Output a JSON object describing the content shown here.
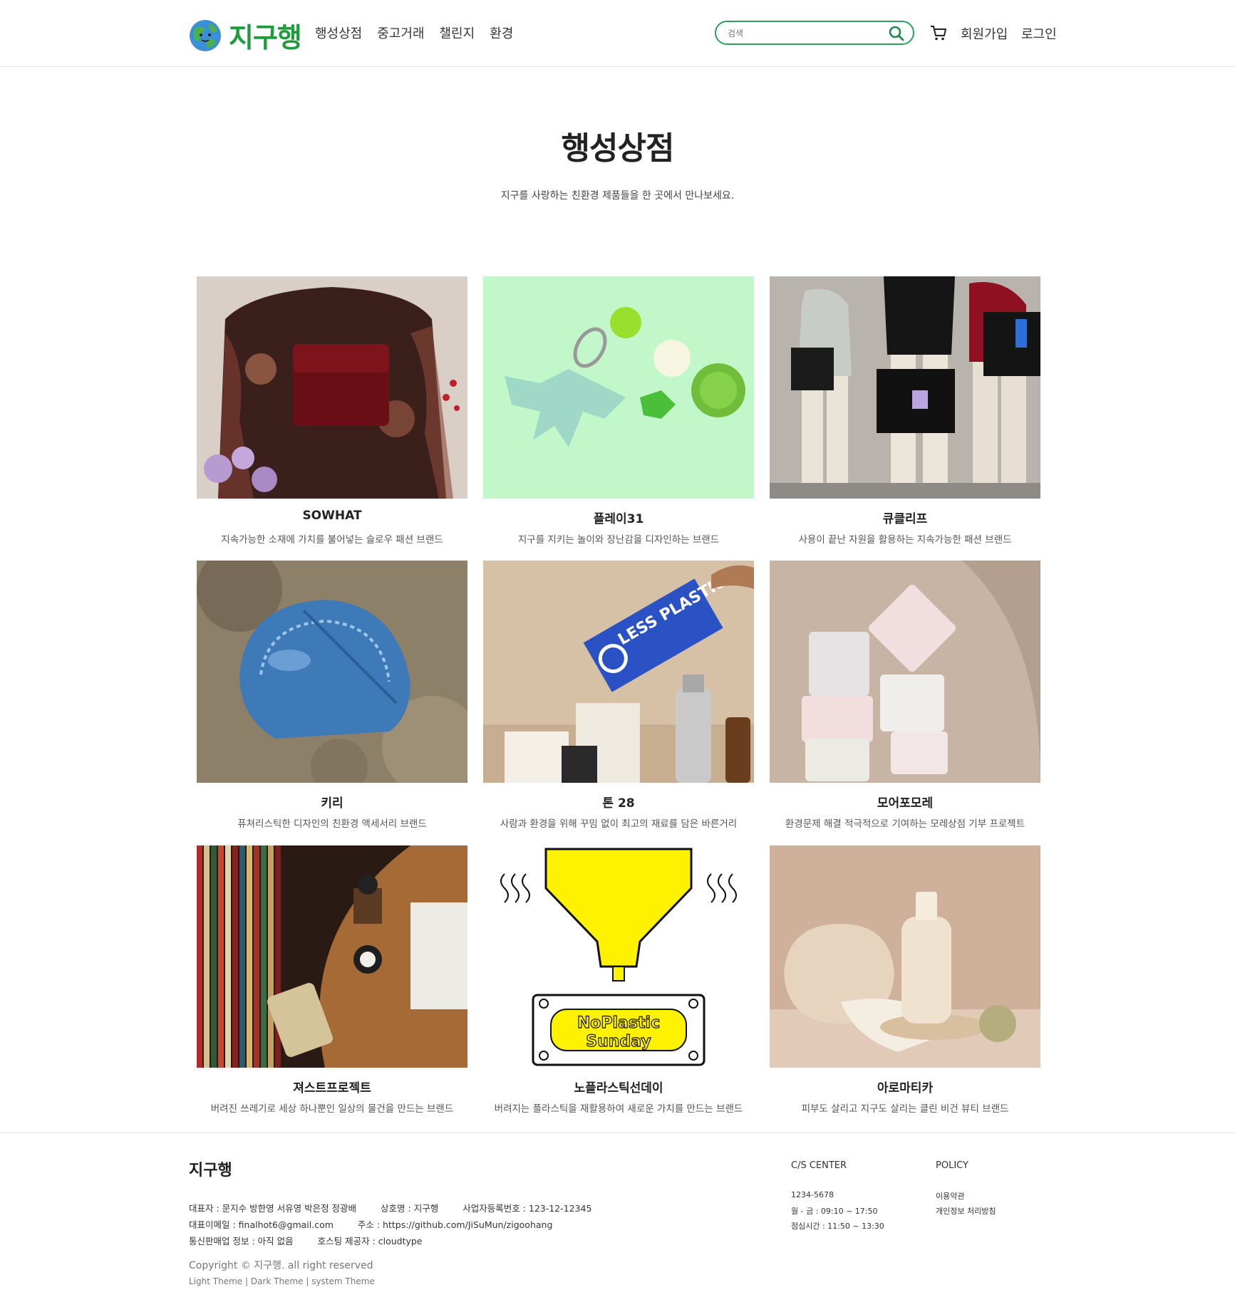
{
  "header": {
    "logo_text": "지구행",
    "nav": [
      "행성상점",
      "중고거래",
      "챌린지",
      "환경"
    ],
    "search_placeholder": "검색",
    "signup": "회원가입",
    "login": "로그인"
  },
  "main": {
    "title": "행성상점",
    "subtitle": "지구를 사랑하는 친환경 제품들을 한 곳에서 만나보세요."
  },
  "brands": [
    {
      "name": "SOWHAT",
      "desc": "지속가능한 소재에 가치를 불어넣는 슬로우 패션 브랜드"
    },
    {
      "name": "플레이31",
      "desc": "지구를 지키는 놀이와 장난감을 디자인하는 브랜드"
    },
    {
      "name": "큐클리프",
      "desc": "사용이 끝난 자원을 활용하는 지속가능한 패션 브랜드"
    },
    {
      "name": "키리",
      "desc": "퓨쳐리스틱한 디자인의 친환경 액세서리 브랜드"
    },
    {
      "name": "톤 28",
      "desc": "사람과 환경을 위해 꾸밈 없이 최고의 재료를 담은 바른거리"
    },
    {
      "name": "모어포모레",
      "desc": "환경문제 해결 적극적으로 기여하는 모레상점 기부 프로젝트"
    },
    {
      "name": "져스트프로젝트",
      "desc": "버려진 쓰레기로 세상 하나뿐인 일상의 물건을 만드는 브랜드"
    },
    {
      "name": "노플라스틱선데이",
      "desc": "버려지는 플라스틱을 재활용하여 새로운 가치를 만드는 브랜드"
    },
    {
      "name": "아로마티카",
      "desc": "피부도 살리고 지구도 살리는 클린 비건 뷰티 브랜드"
    }
  ],
  "image_text": {
    "less_plastic": "LESS PLASTIC",
    "no_plastic_1": "NoPlastic",
    "no_plastic_2": "Sunday"
  },
  "footer": {
    "brand": "지구행",
    "line1": [
      "대표자 : 문지수 방한영 서유영 박은정 정광배",
      "상호명 : 지구행",
      "사업자등록번호 : 123-12-12345"
    ],
    "line2": [
      "대표이메일 : finalhot6@gmail.com",
      "주소 : https://github.com/JiSuMun/zigoohang"
    ],
    "line3": [
      "통신판매업 정보 : 아직 없음",
      "호스팅 제공자 : cloudtype"
    ],
    "copyright": "Copyright © 지구행. all right reserved",
    "themes": [
      "Light Theme",
      "Dark Theme",
      "system Theme"
    ],
    "cs_title": "C/S CENTER",
    "cs_items": [
      "1234-5678",
      "월 - 금 : 09:10 ~ 17:50",
      "점심시간 : 11:50 ~ 13:30"
    ],
    "policy_title": "POLICY",
    "policy_items": [
      "이용약관",
      "개인정보 처리방침"
    ]
  },
  "colors": {
    "brand_green": "#1f9a3c",
    "search_border": "#2aa05a"
  }
}
